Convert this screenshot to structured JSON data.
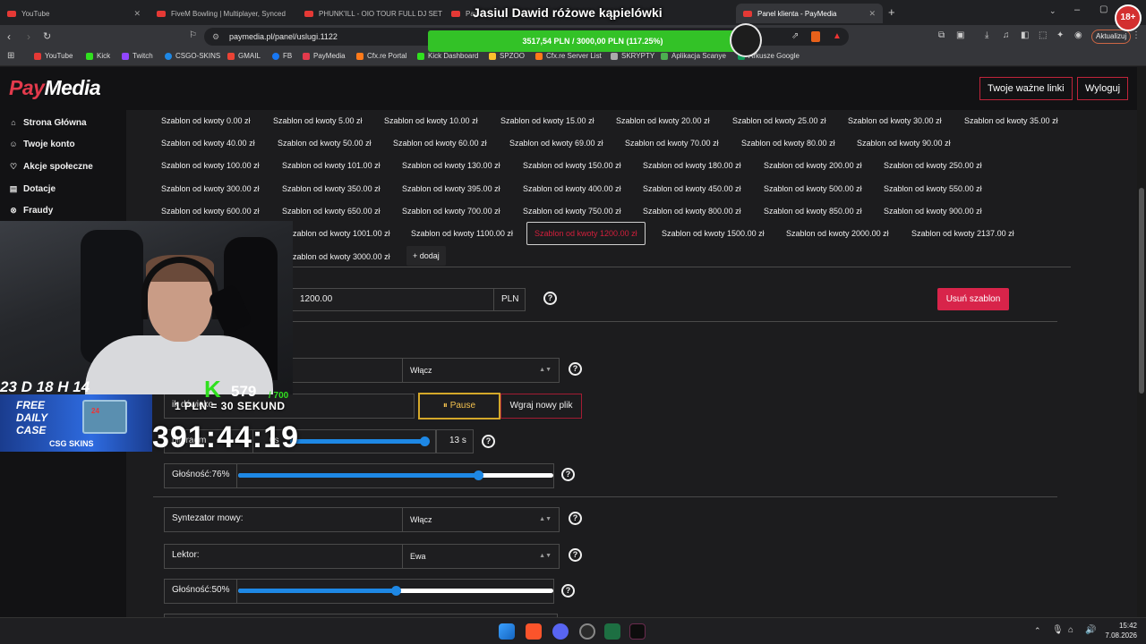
{
  "browser": {
    "tabs": [
      {
        "title": "YouTube"
      },
      {
        "title": "FiveM Bowling | Multiplayer, Synced"
      },
      {
        "title": "PHUNK'ILL - OIO TOUR FULL DJ SET"
      },
      {
        "title": "Pay"
      },
      {
        "title": "Panel klienta - PayMedia"
      }
    ],
    "url": "paymedia.pl/panel/uslugi.1122",
    "update_label": "Aktualizuj",
    "bookmarks": [
      "YouTube",
      "Kick",
      "Twitch",
      "CSGO-SKINS",
      "GMAIL",
      "FB",
      "PayMedia",
      "Cfx.re Portal",
      "Kick Dashboard",
      "SPZOO",
      "Cfx.re Server List",
      "SKRYPTY",
      "Aplikacja Scanye",
      "Arkusze Google"
    ]
  },
  "overlay": {
    "donation_title": "Jasiul Dawid różowe kąpielówki",
    "goal_text": "3517,54 PLN / 3000,00 PLN  (117.25%)",
    "goal_fraction": 1.0,
    "timer": "23 D 18 H 14 M",
    "promo_free": "FREE DAILY CASE",
    "promo_brand": "CSG SKINS",
    "case_label": "24",
    "kick_count": "579",
    "kick_goal": "/ 700",
    "pln_text": "1 PLN = 30 SEKUND",
    "big_clock": "391:44:19",
    "age_badge": "18+"
  },
  "header": {
    "logo_pay": "Pay",
    "logo_media": "Media",
    "links_button": "Twoje ważne linki",
    "logout_button": "Wyloguj"
  },
  "sidebar": {
    "items": [
      {
        "label": "Strona Główna"
      },
      {
        "label": "Twoje konto"
      },
      {
        "label": "Akcje społeczne"
      },
      {
        "label": "Dotacje"
      },
      {
        "label": "Fraudy"
      }
    ]
  },
  "templates": {
    "rows": [
      [
        "Szablon od kwoty 0.00 zł",
        "Szablon od kwoty 5.00 zł",
        "Szablon od kwoty 10.00 zł",
        "Szablon od kwoty 15.00 zł",
        "Szablon od kwoty 20.00 zł",
        "Szablon od kwoty 25.00 zł",
        "Szablon od kwoty 30.00 zł",
        "Szablon od kwoty 35.00 zł"
      ],
      [
        "Szablon od kwoty 40.00 zł",
        "Szablon od kwoty 50.00 zł",
        "Szablon od kwoty 60.00 zł",
        "Szablon od kwoty 69.00 zł",
        "Szablon od kwoty 70.00 zł",
        "Szablon od kwoty 80.00 zł",
        "Szablon od kwoty 90.00 zł"
      ],
      [
        "Szablon od kwoty 100.00 zł",
        "Szablon od kwoty 101.00 zł",
        "Szablon od kwoty 130.00 zł",
        "Szablon od kwoty 150.00 zł",
        "Szablon od kwoty 180.00 zł",
        "Szablon od kwoty 200.00 zł",
        "Szablon od kwoty 250.00 zł"
      ],
      [
        "Szablon od kwoty 300.00 zł",
        "Szablon od kwoty 350.00 zł",
        "Szablon od kwoty 395.00 zł",
        "Szablon od kwoty 400.00 zł",
        "Szablon od kwoty 450.00 zł",
        "Szablon od kwoty 500.00 zł",
        "Szablon od kwoty 550.00 zł"
      ],
      [
        "Szablon od kwoty 600.00 zł",
        "Szablon od kwoty 650.00 zł",
        "Szablon od kwoty 700.00 zł",
        "Szablon od kwoty 750.00 zł",
        "Szablon od kwoty 800.00 zł",
        "Szablon od kwoty 850.00 zł",
        "Szablon od kwoty 900.00 zł"
      ],
      [
        "zablon od kwoty 1001.00 zł",
        "Szablon od kwoty 1100.00 zł",
        "Szablon od kwoty 1200.00 zł",
        "Szablon od kwoty 1500.00 zł",
        "Szablon od kwoty 2000.00 zł",
        "Szablon od kwoty 2137.00 zł"
      ],
      [
        "zablon od kwoty 3000.00 zł",
        "+ dodaj"
      ]
    ],
    "selected": "Szablon od kwoty 1200.00 zł"
  },
  "form": {
    "amount_value": "1200.00",
    "currency": "PLN",
    "delete_button": "Usuń szablon",
    "enabled_select": "Włącz",
    "sound_label": "ik dźwięko",
    "pause_button": "Pause",
    "upload_button": "Wgraj nowy plik",
    "cut_label": "nij fragm",
    "cut_start": "0s",
    "cut_end": "13 s",
    "volume1_label": "Głośność:76%",
    "volume1_level": 0.76,
    "tts_label": "Syntezator mowy:",
    "tts_select": "Włącz",
    "lector_label": "Lektor:",
    "lector_select": "Ewa",
    "volume2_label": "Głośność:50%",
    "volume2_level": 0.5
  },
  "taskbar": {
    "time": "15:42",
    "date": "7.08.2026"
  }
}
